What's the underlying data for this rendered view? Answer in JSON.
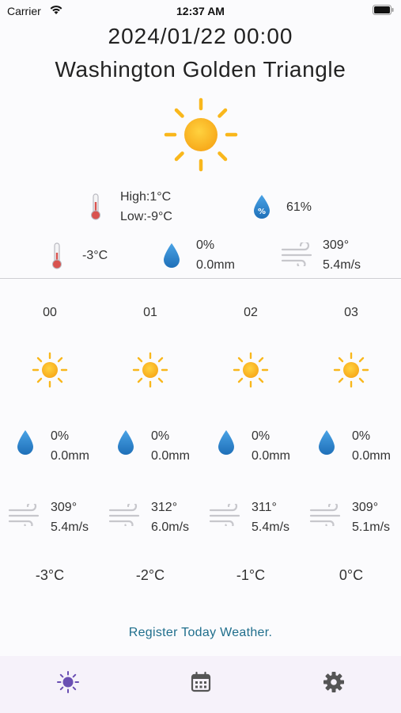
{
  "status_bar": {
    "carrier": "Carrier",
    "time": "12:37 AM"
  },
  "header": {
    "datetime": "2024/01/22 00:00",
    "location": "Washington Golden Triangle"
  },
  "summary": {
    "high": "High:1°C",
    "low": "Low:-9°C",
    "humidity": "61%",
    "humidity_badge": "%",
    "temperature": "-3°C",
    "precip_prob": "0%",
    "precip_amount": "0.0mm",
    "wind_direction": "309°",
    "wind_speed": "5.4m/s"
  },
  "hourly": [
    {
      "hour": "00",
      "precip_prob": "0%",
      "precip_amount": "0.0mm",
      "wind_direction": "309°",
      "wind_speed": "5.4m/s",
      "temperature": "-3°C"
    },
    {
      "hour": "01",
      "precip_prob": "0%",
      "precip_amount": "0.0mm",
      "wind_direction": "312°",
      "wind_speed": "6.0m/s",
      "temperature": "-2°C"
    },
    {
      "hour": "02",
      "precip_prob": "0%",
      "precip_amount": "0.0mm",
      "wind_direction": "311°",
      "wind_speed": "5.4m/s",
      "temperature": "-1°C"
    },
    {
      "hour": "03",
      "precip_prob": "0%",
      "precip_amount": "0.0mm",
      "wind_direction": "309°",
      "wind_speed": "5.1m/s",
      "temperature": "0°C"
    }
  ],
  "register_link": "Register Today Weather.",
  "tabs": [
    {
      "icon": "sun-icon",
      "active": true
    },
    {
      "icon": "calendar-icon",
      "active": false
    },
    {
      "icon": "gear-icon",
      "active": false
    }
  ],
  "colors": {
    "sun": "#f9b71c",
    "drop": "#2a80c8",
    "thermometer": "#d9534f",
    "link": "#1f6e8c",
    "tab_active": "#6a4fb3",
    "tab_inactive": "#555555"
  }
}
